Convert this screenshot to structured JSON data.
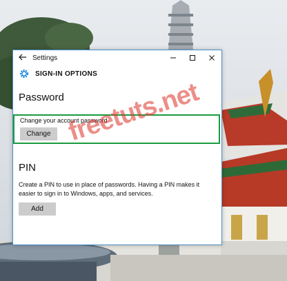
{
  "window": {
    "title": "Settings",
    "header": "SIGN-IN OPTIONS"
  },
  "password": {
    "title": "Password",
    "description": "Change your account password",
    "button": "Change"
  },
  "pin": {
    "title": "PIN",
    "description": "Create a PIN to use in place of passwords. Having a PIN makes it easier to sign in to Windows, apps, and services.",
    "button": "Add"
  },
  "watermark": "freetuts.net",
  "icons": {
    "back": "back-arrow-icon",
    "minimize": "minimize-icon",
    "maximize": "maximize-icon",
    "close": "close-icon",
    "settings": "gear-icon"
  },
  "colors": {
    "window_border": "#4a90c8",
    "highlight": "#1a9a3d",
    "accent": "#0078d7",
    "button_bg": "#cccccc"
  }
}
